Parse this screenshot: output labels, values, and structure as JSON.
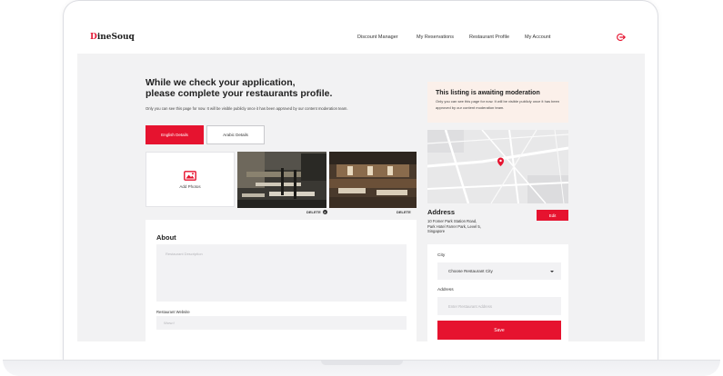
{
  "brand": {
    "logo_first": "D",
    "logo_rest": "ineSouq",
    "accent": "#e6132f"
  },
  "nav": {
    "links": [
      "Discount Manager",
      "My Reservations",
      "Restaurant Profile",
      "My Account"
    ],
    "logout_icon": "logout-icon"
  },
  "intro": {
    "heading_line1": "While we check your application,",
    "heading_line2": "please complete your restaurants profile.",
    "subtext": "Only you can see this page for now. It will be visible publicly once it has been approved by our content moderation team."
  },
  "tabs": {
    "english": "English Details",
    "arabic": "Arabic Details"
  },
  "photos": {
    "add_label": "Add Photos",
    "delete_label": "DELETE",
    "delete_label_2": "DELETE"
  },
  "about": {
    "title": "About",
    "description_placeholder": "Restaurant Description",
    "website_label": "Restaurant Website",
    "website_placeholder": "Www.f"
  },
  "moderation": {
    "title": "This listing is awaiting moderation",
    "text": "Only you can see this page for now. It will be visible publicly once it has been approved by our content moderation team."
  },
  "address": {
    "title": "Address",
    "text": "10 Fomer Park Station Road, Park Hotel Farrer Park, Level 5, Singapore",
    "edit_label": "Edit"
  },
  "form": {
    "city_label": "City",
    "city_value": "Choose Restaurant City",
    "address_label": "Address",
    "address_placeholder": "Enter Restaurant Address",
    "save_label": "Save"
  }
}
